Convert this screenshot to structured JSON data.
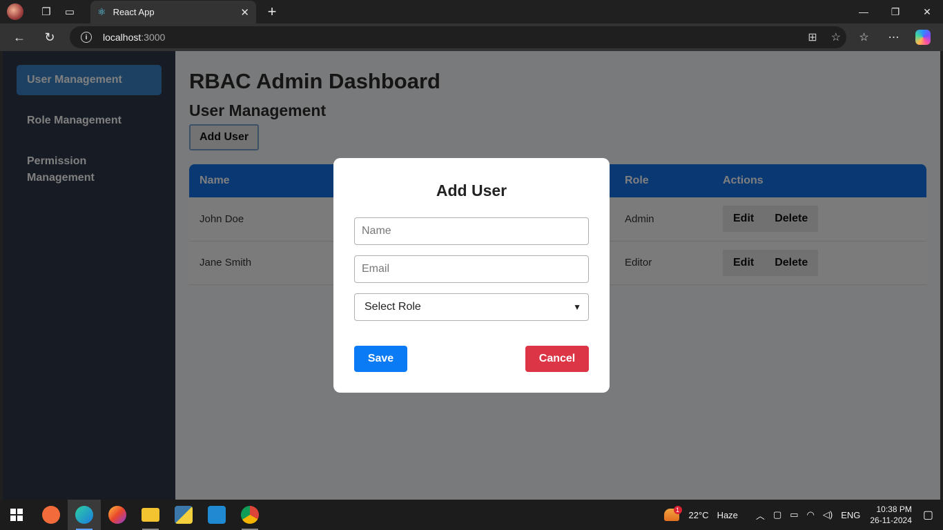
{
  "browser": {
    "tab_title": "React App",
    "url_host": "localhost",
    "url_port": ":3000"
  },
  "sidebar": {
    "items": [
      {
        "label": "User Management",
        "active": true
      },
      {
        "label": "Role Management",
        "active": false
      },
      {
        "label": "Permission Management",
        "active": false
      }
    ]
  },
  "main": {
    "title": "RBAC Admin Dashboard",
    "section_title": "User Management",
    "add_user_label": "Add User",
    "table": {
      "headers": [
        "Name",
        "Role",
        "Actions"
      ],
      "rows": [
        {
          "name": "John Doe",
          "role": "Admin"
        },
        {
          "name": "Jane Smith",
          "role": "Editor"
        }
      ],
      "edit_label": "Edit",
      "delete_label": "Delete"
    }
  },
  "modal": {
    "title": "Add User",
    "name_placeholder": "Name",
    "email_placeholder": "Email",
    "role_selected": "Select Role",
    "save_label": "Save",
    "cancel_label": "Cancel"
  },
  "taskbar": {
    "temperature": "22°C",
    "weather": "Haze",
    "weather_badge": "1",
    "language": "ENG",
    "time": "10:38 PM",
    "date": "26-11-2024"
  },
  "colors": {
    "sidebar_bg": "#2d3748",
    "sidebar_active": "#3b82c4",
    "table_header": "#1470e6",
    "save_button": "#0a7af5",
    "cancel_button": "#dc3545"
  }
}
